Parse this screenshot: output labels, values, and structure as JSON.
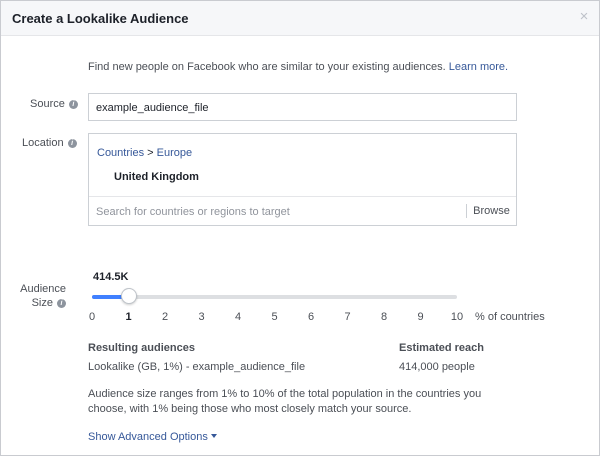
{
  "dialog": {
    "title": "Create a Lookalike Audience",
    "close_glyph": "×"
  },
  "intro": {
    "text": "Find new people on Facebook who are similar to your existing audiences.",
    "link": "Learn more."
  },
  "source": {
    "label": "Source",
    "value": "example_audience_file"
  },
  "location": {
    "label": "Location",
    "breadcrumb": [
      "Countries",
      "Europe"
    ],
    "breadcrumb_sep": ">",
    "selected_country": "United Kingdom",
    "search_placeholder": "Search for countries or regions to target",
    "browse_label": "Browse"
  },
  "audience_size": {
    "label_line1": "Audience",
    "label_line2": "Size",
    "value": "414.5K",
    "selected_percent": 1,
    "min": 0,
    "max": 10,
    "ticks": [
      "0",
      "1",
      "2",
      "3",
      "4",
      "5",
      "6",
      "7",
      "8",
      "9",
      "10"
    ],
    "unit": "% of countries"
  },
  "results": {
    "resulting_header": "Resulting audiences",
    "resulting_value": "Lookalike (GB, 1%) - example_audience_file",
    "reach_header": "Estimated reach",
    "reach_value": "414,000 people"
  },
  "note": "Audience size ranges from 1% to 10% of the total population in the countries you choose, with 1% being those who most closely match your source.",
  "advanced": {
    "label": "Show Advanced Options"
  },
  "info_icon_glyph": "i",
  "colors": {
    "accent": "#4080ff",
    "link": "#365899"
  }
}
